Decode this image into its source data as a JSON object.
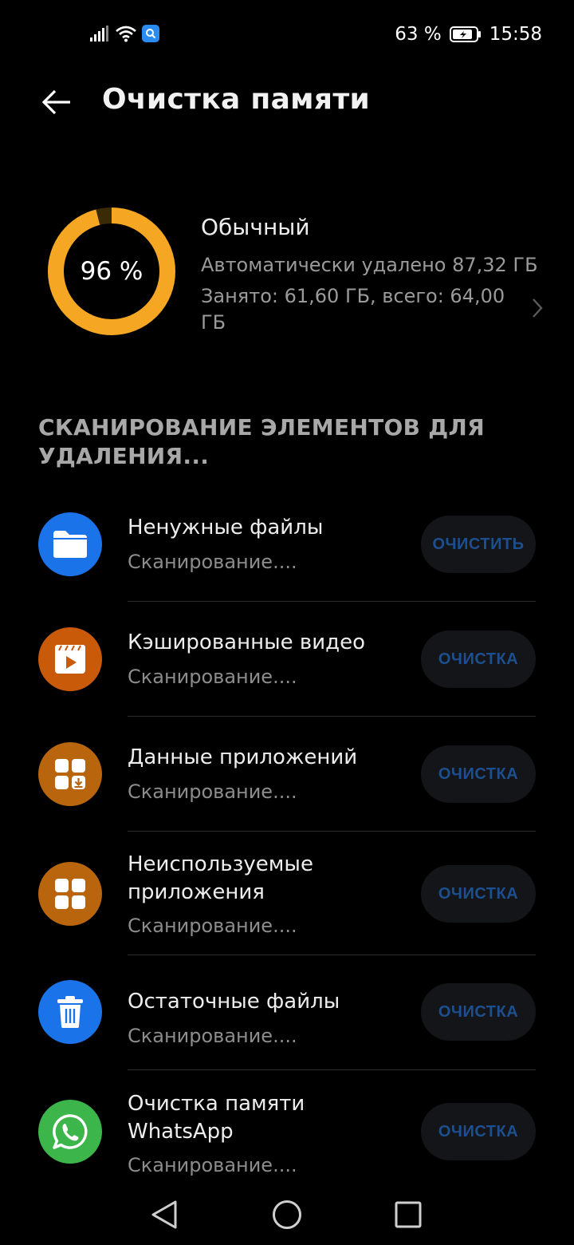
{
  "status_bar": {
    "battery_text": "63 %",
    "time": "15:58"
  },
  "header": {
    "title": "Очистка памяти"
  },
  "storage": {
    "percent": 96,
    "percent_label": "96 %",
    "status": "Обычный",
    "auto_deleted": "Автоматически удалено 87,32 ГБ",
    "usage": "Занято: 61,60 ГБ, всего: 64,00 ГБ",
    "ring_color": "#f5a623"
  },
  "section": {
    "heading": "СКАНИРОВАНИЕ ЭЛЕМЕНТОВ ДЛЯ УДАЛЕНИЯ..."
  },
  "items": [
    {
      "title": "Ненужные файлы",
      "subtitle": "Сканирование....",
      "button": "ОЧИСТИТЬ",
      "icon": "folder-icon",
      "icon_color": "#1a73e8"
    },
    {
      "title": "Кэшированные видео",
      "subtitle": "Сканирование....",
      "button": "ОЧИСТКА",
      "icon": "video-icon",
      "icon_color": "#c85a0a"
    },
    {
      "title": "Данные приложений",
      "subtitle": "Сканирование....",
      "button": "ОЧИСТКА",
      "icon": "app-data-icon",
      "icon_color": "#b8650e"
    },
    {
      "title": "Неиспользуемые приложения",
      "subtitle": "Сканирование....",
      "button": "ОЧИСТКА",
      "icon": "apps-grid-icon",
      "icon_color": "#b8650e"
    },
    {
      "title": "Остаточные файлы",
      "subtitle": "Сканирование....",
      "button": "ОЧИСТКА",
      "icon": "trash-icon",
      "icon_color": "#1a73e8"
    },
    {
      "title": "Очистка памяти WhatsApp",
      "subtitle": "Сканирование....",
      "button": "ОЧИСТКА",
      "icon": "whatsapp-icon",
      "icon_color": "#3cb54a"
    }
  ]
}
